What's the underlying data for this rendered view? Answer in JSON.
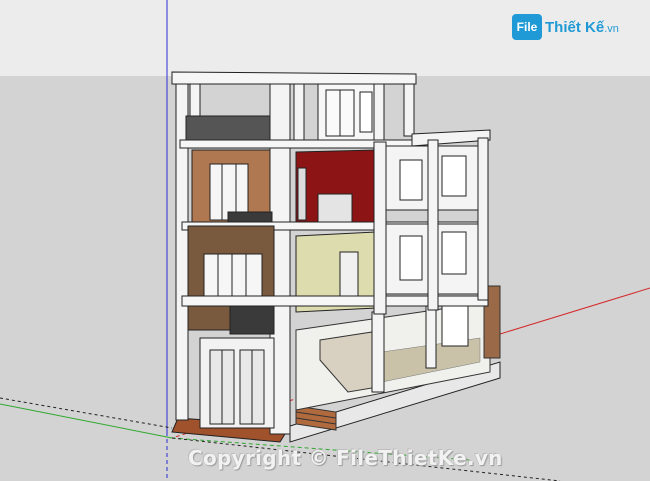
{
  "watermark": {
    "logo_mark": "File",
    "logo_name": "Thiết Kế",
    "logo_domain": ".vn",
    "copyright": "Copyright © FileThietKe.vn"
  },
  "viewport": {
    "axes": [
      "red-axis",
      "green-axis",
      "blue-axis"
    ],
    "colors": {
      "sky": "#ececec",
      "ground": "#d3d3d3",
      "red_axis": "#d42a2a",
      "green_axis": "#2fa82f",
      "blue_axis": "#2b2bd8",
      "accent_wall": "#8c1414",
      "cream_wall": "#dcdcae",
      "brick_wall": "#9a6a48",
      "brand": "#1f9ad6"
    }
  }
}
